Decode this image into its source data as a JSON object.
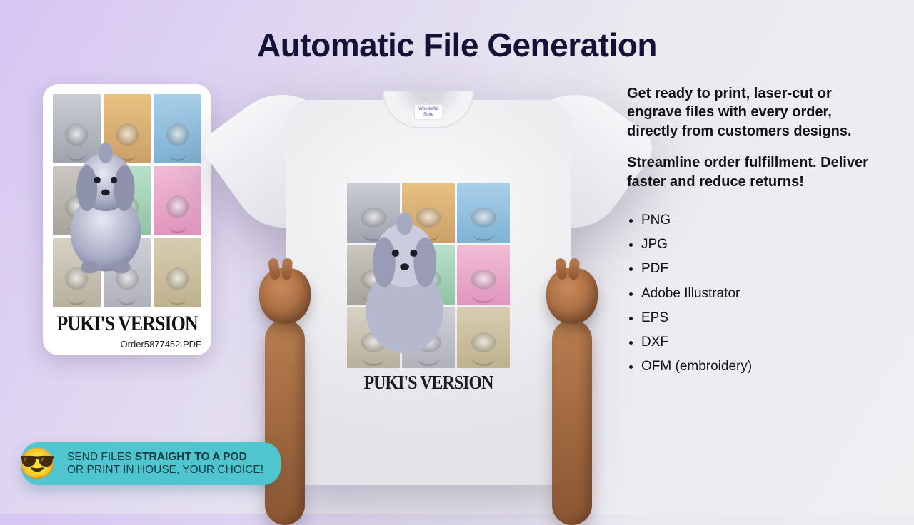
{
  "title": "Automatic File Generation",
  "card": {
    "version_label": "PUKI'S VERSION",
    "filename": "Order5877452.PDF"
  },
  "shirt": {
    "tag_label": "Wonderful Store",
    "version_label": "PUKI'S VERSION"
  },
  "right": {
    "p1": "Get ready to print, laser-cut or engrave files with every order, directly from customers designs.",
    "p2": "Streamline order fulfillment. Deliver faster and reduce returns!",
    "formats": [
      "PNG",
      "JPG",
      "PDF",
      "Adobe Illustrator",
      "EPS",
      "DXF",
      "OFM (embroidery)"
    ]
  },
  "callout": {
    "emoji": "😎",
    "line1_pre": "SEND FILES ",
    "line1_bold": "STRAIGHT TO A POD",
    "line2": "OR PRINT IN HOUSE, YOUR CHOICE!"
  }
}
